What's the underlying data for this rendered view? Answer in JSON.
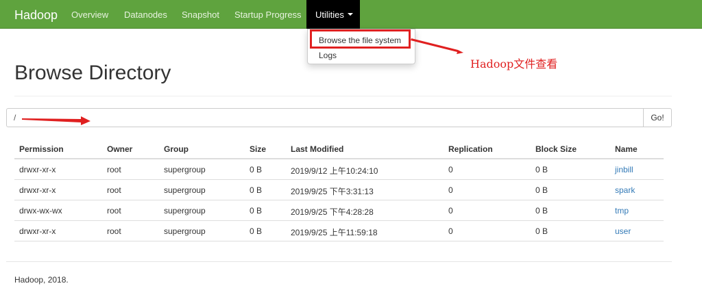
{
  "navbar": {
    "brand": "Hadoop",
    "items": [
      "Overview",
      "Datanodes",
      "Snapshot",
      "Startup Progress"
    ],
    "active_item": "Utilities"
  },
  "dropdown": {
    "items": [
      "Browse the file system",
      "Logs"
    ]
  },
  "annotation": {
    "text": "Hadoop文件查看",
    "color": "#e02020"
  },
  "page": {
    "title": "Browse Directory"
  },
  "path": {
    "value": "/",
    "go_label": "Go!"
  },
  "table": {
    "headers": [
      "Permission",
      "Owner",
      "Group",
      "Size",
      "Last Modified",
      "Replication",
      "Block Size",
      "Name"
    ],
    "rows": [
      [
        "drwxr-xr-x",
        "root",
        "supergroup",
        "0 B",
        "2019/9/12 上午10:24:10",
        "0",
        "0 B",
        "jinbill"
      ],
      [
        "drwxr-xr-x",
        "root",
        "supergroup",
        "0 B",
        "2019/9/25 下午3:31:13",
        "0",
        "0 B",
        "spark"
      ],
      [
        "drwx-wx-wx",
        "root",
        "supergroup",
        "0 B",
        "2019/9/25 下午4:28:28",
        "0",
        "0 B",
        "tmp"
      ],
      [
        "drwxr-xr-x",
        "root",
        "supergroup",
        "0 B",
        "2019/9/25 上午11:59:18",
        "0",
        "0 B",
        "user"
      ]
    ]
  },
  "footer": {
    "text": "Hadoop, 2018."
  },
  "colors": {
    "navbar": "#5fa33e",
    "link": "#337ab7",
    "highlight": "#e02020"
  }
}
